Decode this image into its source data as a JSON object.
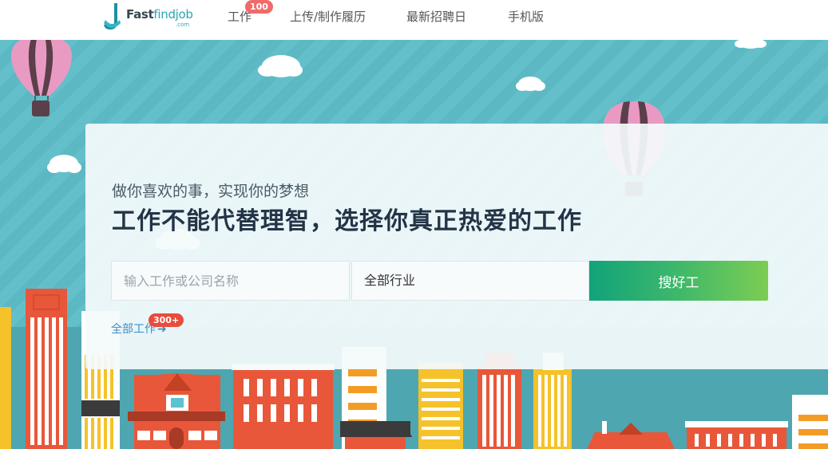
{
  "header": {
    "logo": {
      "brand_main": "Fast",
      "brand_accent": "findjob",
      "brand_sub": ".com"
    },
    "nav": [
      {
        "label": "工作",
        "badge": "100"
      },
      {
        "label": "上传/制作履历"
      },
      {
        "label": "最新招聘日"
      },
      {
        "label": "手机版"
      }
    ]
  },
  "hero": {
    "slogan_sub": "做你喜欢的事，实现你的梦想",
    "slogan_main": "工作不能代替理智，选择你真正热爱的工作",
    "search": {
      "keyword_placeholder": "输入工作或公司名称",
      "keyword_value": "",
      "industry_selected": "全部行业",
      "submit_label": "搜好工"
    },
    "all_jobs": {
      "label": "全部工作",
      "badge": "300+"
    }
  },
  "colors": {
    "sky": "#63c0cb",
    "button_start": "#11a37a",
    "button_end": "#7ccd52",
    "badge_red": "#e74c3c",
    "link_blue": "#3a8fc6"
  }
}
